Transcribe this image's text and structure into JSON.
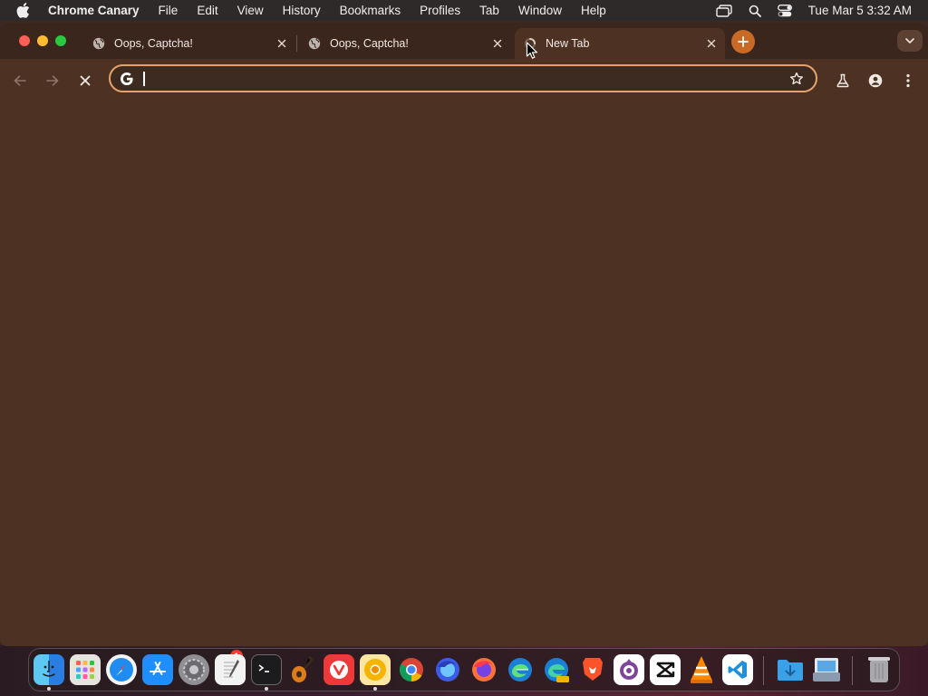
{
  "menubar": {
    "app_name": "Chrome Canary",
    "items": [
      "File",
      "Edit",
      "View",
      "History",
      "Bookmarks",
      "Profiles",
      "Tab",
      "Window",
      "Help"
    ],
    "clock": "Tue Mar 5  3:32 AM"
  },
  "tabs": [
    {
      "title": "Oops, Captcha!",
      "active": false,
      "favicon": "globe-icon"
    },
    {
      "title": "Oops, Captcha!",
      "active": false,
      "favicon": "globe-icon"
    },
    {
      "title": "New Tab",
      "active": true,
      "favicon": "loading-icon"
    }
  ],
  "omnibox": {
    "value": "",
    "search_engine_icon": "google-g-icon"
  },
  "toolbar_icons": [
    "back-icon",
    "forward-icon",
    "stop-icon",
    "star-icon",
    "labs-flask-icon",
    "profile-icon",
    "menu-kebab-icon"
  ],
  "dock": {
    "apps": [
      "Finder",
      "Launchpad",
      "Safari",
      "App Store",
      "System Settings",
      "TextEdit",
      "Terminal",
      "GarageBand",
      "Vivaldi",
      "Chrome Canary",
      "Google Chrome",
      "Firefox Developer Edition",
      "Firefox",
      "Microsoft Edge",
      "Microsoft Edge Canary",
      "Brave",
      "Tor Browser",
      "CapCut",
      "VLC",
      "Visual Studio Code",
      "Downloads",
      "Preview",
      "Trash"
    ],
    "settings_badge": "1"
  },
  "colors": {
    "window_bg": "#4d3224",
    "tabstrip_bg": "#3a261c",
    "omnibox_border": "#e5a26a",
    "new_tab_button": "#c86a23"
  }
}
